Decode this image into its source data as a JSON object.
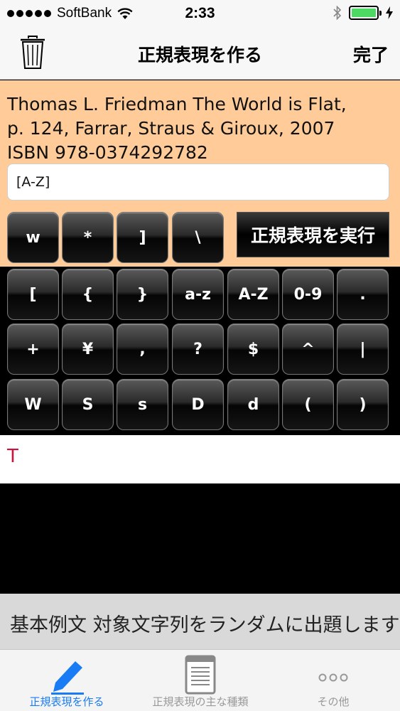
{
  "status_bar": {
    "carrier": "SoftBank",
    "time": "2:33"
  },
  "nav": {
    "title": "正規表現を作る",
    "done_label": "完了",
    "trash_icon": "trash-icon"
  },
  "target": {
    "line1": "Thomas L. Friedman The World is Flat,",
    "line2": "p. 124, Farrar, Straus & Giroux, 2007",
    "line3": "ISBN 978-0374292782"
  },
  "regex_input": {
    "value": "[A-Z]"
  },
  "execute_label": "正規表現を実行",
  "keys": {
    "row0": [
      "w",
      "*",
      "]",
      "\\"
    ],
    "row1": [
      "[",
      "{",
      "}",
      "a-z",
      "A-Z",
      "0-9",
      "."
    ],
    "row2": [
      "+",
      "¥",
      ",",
      "?",
      "$",
      "^",
      "|"
    ],
    "row3": [
      "W",
      "S",
      "s",
      "D",
      "d",
      "(",
      ")"
    ]
  },
  "result": {
    "text": "T"
  },
  "banner": {
    "text": "基本例文 対象文字列をランダムに出題します"
  },
  "tabs": [
    {
      "label": "正規表現を作る",
      "icon": "pencil-icon"
    },
    {
      "label": "正規表現の主な種類",
      "icon": "document-icon"
    },
    {
      "label": "その他",
      "icon": "more-icon"
    }
  ],
  "colors": {
    "accent": "#1a7cf5",
    "target_bg": "#ffcc99",
    "result_text": "#d0103a",
    "battery": "#4cd964"
  },
  "battery_level": 1.0
}
